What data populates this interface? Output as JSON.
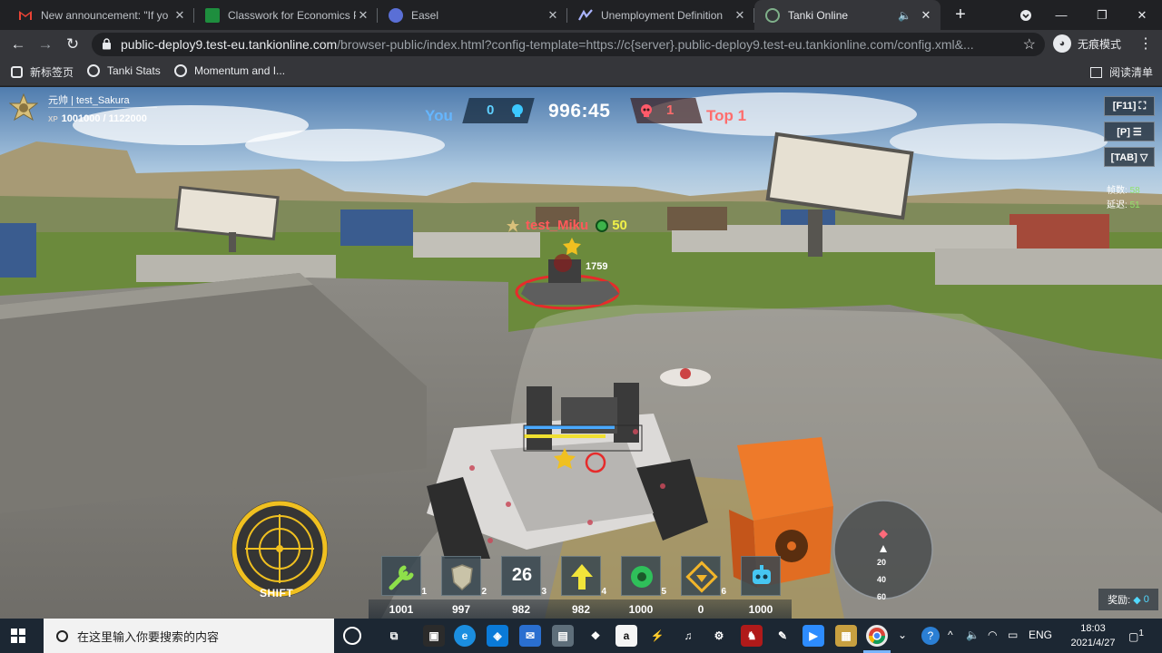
{
  "browser": {
    "tabs": [
      {
        "title": "New announcement: \"If yo",
        "icon": "gmail-icon",
        "active": false
      },
      {
        "title": "Classwork for Economics P",
        "icon": "classroom-icon",
        "active": false
      },
      {
        "title": "Easel",
        "icon": "easel-icon",
        "active": false
      },
      {
        "title": "Unemployment Definition",
        "icon": "investopedia-icon",
        "active": false
      },
      {
        "title": "Tanki Online",
        "icon": "tanki-icon",
        "active": true
      }
    ],
    "address": {
      "host": "public-deploy9.test-eu.tankionline.com",
      "path": "/browser-public/index.html?config-template=https://c{server}.public-deploy9.test-eu.tankionline.com/config.xml&..."
    },
    "profile_label": "无痕模式",
    "bookmarks": [
      {
        "label": "新标签页"
      },
      {
        "label": "Tanki Stats"
      },
      {
        "label": "Momentum and I..."
      }
    ],
    "reading_list": "阅读清单"
  },
  "game": {
    "player": {
      "name": "元帅 | test_Sakura",
      "xp_label": "XP",
      "xp": "1001000 / 1122000"
    },
    "score": {
      "you_label": "You",
      "you_score": "0",
      "timer": "996:45",
      "enemy_score": "1",
      "enemy_label": "Top 1"
    },
    "keys": [
      "[F11] ⛶",
      "[P] ☰",
      "[TAB] ▽"
    ],
    "stats": {
      "fps_label": "帧数:",
      "fps": "58",
      "ping_label": "延迟:",
      "ping": "51"
    },
    "enemy": {
      "name": "test_Miku",
      "level": "50",
      "damage": "1759"
    },
    "shift_label": "SHIFT",
    "supplies": [
      {
        "key": "1",
        "count": "1001",
        "icon": "repair-kit-icon"
      },
      {
        "key": "2",
        "count": "997",
        "icon": "armor-shield-icon"
      },
      {
        "key": "3",
        "count": "982",
        "icon": "mine-counter-icon",
        "big": "26"
      },
      {
        "key": "4",
        "count": "982",
        "icon": "speed-boost-icon"
      },
      {
        "key": "5",
        "count": "1000",
        "icon": "mine-icon"
      },
      {
        "key": "6",
        "count": "0",
        "icon": "gold-box-icon"
      },
      {
        "key": "",
        "count": "1000",
        "icon": "drone-icon"
      }
    ],
    "radar": {
      "ticks": [
        "20",
        "40",
        "60"
      ]
    },
    "reward": {
      "label": "奖励:",
      "value": "0"
    },
    "colors": {
      "team_blue": "#65b6ff",
      "team_red": "#ff6d6d",
      "accent_yellow": "#f0c020"
    }
  },
  "taskbar": {
    "search_placeholder": "在这里输入你要搜索的内容",
    "lang": "ENG",
    "time": "18:03",
    "date": "2021/4/27",
    "notifications": "1"
  }
}
